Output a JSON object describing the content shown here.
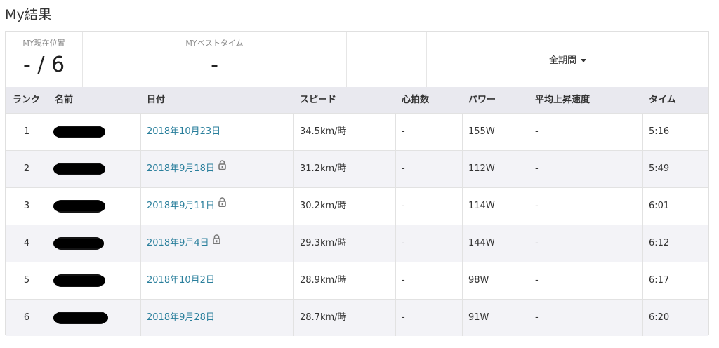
{
  "page": {
    "title": "My結果"
  },
  "summary": {
    "position_label": "MY現在位置",
    "position_value": "- / 6",
    "best_time_label": "MYベストタイム",
    "best_time_value": "-",
    "period_label": "全期間"
  },
  "table": {
    "headers": [
      "ランク",
      "名前",
      "日付",
      "スピード",
      "心拍数",
      "パワー",
      "平均上昇速度",
      "タイム"
    ],
    "rows": [
      {
        "rank": "1",
        "date": "2018年10月23日",
        "locked": false,
        "speed": "34.5km/時",
        "heart_rate": "-",
        "power": "155W",
        "climb": "-",
        "time": "5:16"
      },
      {
        "rank": "2",
        "date": "2018年9月18日",
        "locked": true,
        "speed": "31.2km/時",
        "heart_rate": "-",
        "power": "112W",
        "climb": "-",
        "time": "5:49"
      },
      {
        "rank": "3",
        "date": "2018年9月11日",
        "locked": true,
        "speed": "30.2km/時",
        "heart_rate": "-",
        "power": "114W",
        "climb": "-",
        "time": "6:01"
      },
      {
        "rank": "4",
        "date": "2018年9月4日",
        "locked": true,
        "speed": "29.3km/時",
        "heart_rate": "-",
        "power": "144W",
        "climb": "-",
        "time": "6:12"
      },
      {
        "rank": "5",
        "date": "2018年10月2日",
        "locked": false,
        "speed": "28.9km/時",
        "heart_rate": "-",
        "power": "98W",
        "climb": "-",
        "time": "6:17"
      },
      {
        "rank": "6",
        "date": "2018年9月28日",
        "locked": false,
        "speed": "28.7km/時",
        "heart_rate": "-",
        "power": "91W",
        "climb": "-",
        "time": "6:20"
      }
    ]
  },
  "colors": {
    "link": "#2a7f9c",
    "header_bg": "#e9e9ef",
    "alt_row_bg": "#f3f3f7"
  },
  "icons": {
    "lock": "lock-icon",
    "caret": "caret-down-icon"
  }
}
